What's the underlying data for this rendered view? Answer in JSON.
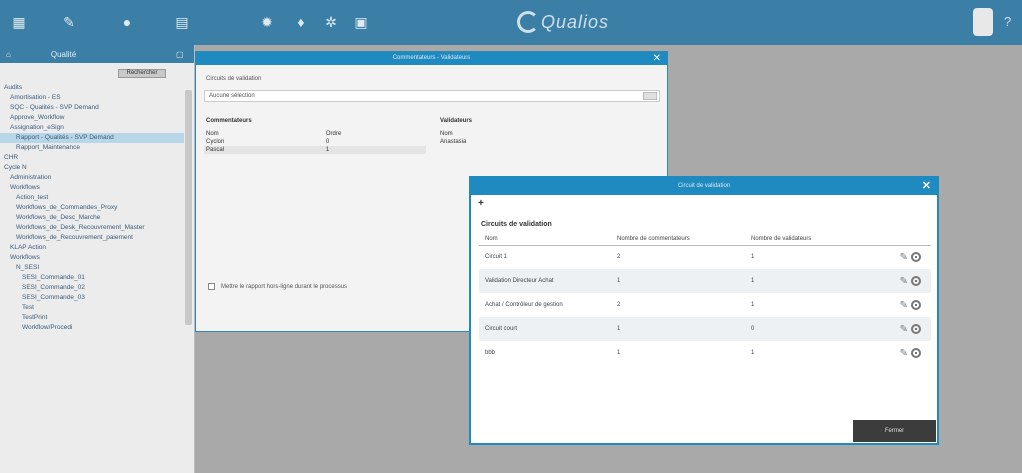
{
  "topbar": {
    "icons": [
      "grid-icon",
      "pen-icon",
      "circle-icon",
      "chart-icon",
      "gear-icon",
      "bulb-icon",
      "cog-icon",
      "document-icon"
    ],
    "brand": "Qualios"
  },
  "sidebar": {
    "header": "Qualité",
    "search_button": "Rechercher",
    "tree": [
      {
        "label": "Audits",
        "indent": 4
      },
      {
        "label": "Amortisation - ES",
        "indent": 10
      },
      {
        "label": "SQC - Qualités - SVP Demand",
        "indent": 10
      },
      {
        "label": "Approve_Workflow",
        "indent": 10
      },
      {
        "label": "Assignation_eSign",
        "indent": 10
      },
      {
        "label": "Rapport - Qualités - SVP Demand",
        "indent": 16,
        "selected": true
      },
      {
        "label": "Rapport_Maintenance",
        "indent": 16
      },
      {
        "label": "CHR",
        "indent": 4
      },
      {
        "label": "Cycle N",
        "indent": 4
      },
      {
        "label": "Administration",
        "indent": 10
      },
      {
        "label": "Workflows",
        "indent": 10
      },
      {
        "label": "Action_test",
        "indent": 16
      },
      {
        "label": "Workflows_de_Commandes_Proxy",
        "indent": 16
      },
      {
        "label": "Workflows_de_Desc_Marche",
        "indent": 16
      },
      {
        "label": "Workflows_de_Desk_Recouvrement_Master",
        "indent": 16
      },
      {
        "label": "Workflows_de_Recouvrement_paiement",
        "indent": 16
      },
      {
        "label": "KLAP Action",
        "indent": 10
      },
      {
        "label": "Workflows",
        "indent": 10
      },
      {
        "label": "N_SESI",
        "indent": 16
      },
      {
        "label": "SESI_Commande_01",
        "indent": 22
      },
      {
        "label": "SESI_Commande_02",
        "indent": 22
      },
      {
        "label": "SESI_Commande_03",
        "indent": 22
      },
      {
        "label": "Test",
        "indent": 22
      },
      {
        "label": "TestPrint",
        "indent": 22
      },
      {
        "label": "Workflow/Procedi",
        "indent": 22
      }
    ]
  },
  "dialog1": {
    "title": "Commentateurs - Validateurs",
    "circuit_label": "Circuits de validation",
    "select_value": "Aucune sélection",
    "comm_header": "Commentateurs",
    "comm_cols": [
      "Nom",
      "Ordre"
    ],
    "comm_rows": [
      [
        "Cyclon",
        "0"
      ],
      [
        "Pascal",
        "1"
      ]
    ],
    "val_header": "Validateurs",
    "val_cols": [
      "Nom"
    ],
    "val_rows": [
      [
        "Anastasia"
      ]
    ],
    "checkbox_label": "Mettre le rapport hors-ligne durant le processus"
  },
  "dialog2": {
    "title": "Circuit de validation",
    "add": "+",
    "heading": "Circuits de validation",
    "cols": [
      "Nom",
      "Nombre de commentateurs",
      "Nombre de validateurs"
    ],
    "rows": [
      [
        "Circuit 1",
        "2",
        "1"
      ],
      [
        "Validation Directeur Achat",
        "1",
        "1"
      ],
      [
        "Achat / Contrôleur de gestion",
        "2",
        "1"
      ],
      [
        "Circuit court",
        "1",
        "0"
      ],
      [
        "bbb",
        "1",
        "1"
      ]
    ],
    "close_button": "Fermer"
  }
}
